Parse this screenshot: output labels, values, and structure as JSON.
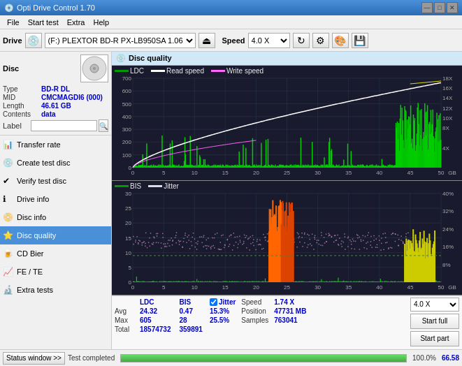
{
  "titlebar": {
    "title": "Opti Drive Control 1.70",
    "controls": [
      "—",
      "□",
      "✕"
    ]
  },
  "menubar": {
    "items": [
      "File",
      "Start test",
      "Extra",
      "Help"
    ]
  },
  "toolbar": {
    "drive_label": "Drive",
    "drive_value": "(F:) PLEXTOR BD-R  PX-LB950SA 1.06",
    "speed_label": "Speed",
    "speed_value": "4.0 X"
  },
  "sidebar": {
    "disc_title": "Disc",
    "disc_info": {
      "type_label": "Type",
      "type_value": "BD-R DL",
      "mid_label": "MID",
      "mid_value": "CMCMAGDI6 (000)",
      "length_label": "Length",
      "length_value": "46.61 GB",
      "contents_label": "Contents",
      "contents_value": "data",
      "label_label": "Label",
      "label_value": ""
    },
    "nav_items": [
      {
        "id": "transfer-rate",
        "label": "Transfer rate",
        "icon": "📊"
      },
      {
        "id": "create-test-disc",
        "label": "Create test disc",
        "icon": "💿"
      },
      {
        "id": "verify-test-disc",
        "label": "Verify test disc",
        "icon": "✔"
      },
      {
        "id": "drive-info",
        "label": "Drive info",
        "icon": "ℹ"
      },
      {
        "id": "disc-info",
        "label": "Disc info",
        "icon": "📀"
      },
      {
        "id": "disc-quality",
        "label": "Disc quality",
        "icon": "⭐",
        "active": true
      },
      {
        "id": "cd-bier",
        "label": "CD Bier",
        "icon": "🍺"
      },
      {
        "id": "fe-te",
        "label": "FE / TE",
        "icon": "📈"
      },
      {
        "id": "extra-tests",
        "label": "Extra tests",
        "icon": "🔬"
      }
    ]
  },
  "disc_quality": {
    "title": "Disc quality",
    "legend": {
      "ldc_label": "LDC",
      "ldc_color": "#009900",
      "read_speed_label": "Read speed",
      "read_speed_color": "#ffffff",
      "write_speed_label": "Write speed",
      "write_speed_color": "#ff66ff",
      "bis_label": "BIS",
      "bis_color": "#009900",
      "jitter_label": "Jitter",
      "jitter_color": "#dddddd"
    },
    "stats": {
      "headers": [
        "",
        "LDC",
        "BIS",
        "",
        "Jitter",
        "Speed",
        ""
      ],
      "avg_label": "Avg",
      "avg_ldc": "24.32",
      "avg_bis": "0.47",
      "avg_jitter": "15.3%",
      "avg_speed_label": "1.74 X",
      "max_label": "Max",
      "max_ldc": "605",
      "max_bis": "28",
      "max_jitter": "25.5%",
      "position_label": "Position",
      "position_value": "47731 MB",
      "total_label": "Total",
      "total_ldc": "18574732",
      "total_bis": "359891",
      "samples_label": "Samples",
      "samples_value": "763041",
      "speed_select": "4.0 X",
      "start_full_label": "Start full",
      "start_part_label": "Start part"
    }
  },
  "statusbar": {
    "status_window_label": "Status window >>",
    "status_text": "Test completed",
    "progress": 100,
    "speed": "66.58"
  }
}
